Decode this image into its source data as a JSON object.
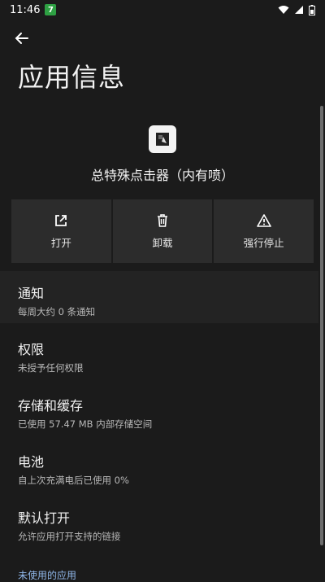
{
  "status_bar": {
    "time": "11:46",
    "notification_badge": "7"
  },
  "header": {
    "title": "应用信息"
  },
  "app": {
    "name": "总特殊点击器（内有喷）"
  },
  "actions": [
    {
      "label": "打开"
    },
    {
      "label": "卸载"
    },
    {
      "label": "强行停止"
    }
  ],
  "sections": [
    {
      "title": "通知",
      "subtitle": "每周大约 0 条通知"
    },
    {
      "title": "权限",
      "subtitle": "未授予任何权限"
    },
    {
      "title": "存储和缓存",
      "subtitle": "已使用 57.47 MB 内部存储空间"
    },
    {
      "title": "电池",
      "subtitle": "自上次充满电后已使用 0%"
    },
    {
      "title": "默认打开",
      "subtitle": "允许应用打开支持的链接"
    }
  ],
  "footer_section_label": "未使用的应用",
  "colors": {
    "background": "#1b1b1b",
    "action_bg": "#2c2c2c",
    "accent_badge": "#2ea043"
  }
}
